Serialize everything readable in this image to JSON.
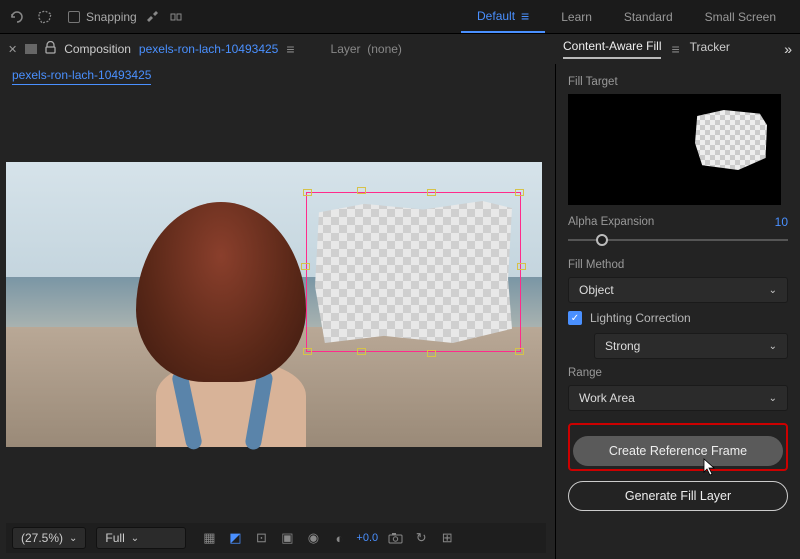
{
  "topbar": {
    "snapping_label": "Snapping"
  },
  "workspace": {
    "tabs": [
      "Default",
      "Learn",
      "Standard",
      "Small Screen"
    ],
    "active": "Default"
  },
  "comp_header": {
    "label": "Composition",
    "name": "pexels-ron-lach-10493425",
    "layer_label": "Layer",
    "layer_value": "(none)"
  },
  "breadcrumb": {
    "item": "pexels-ron-lach-10493425"
  },
  "right_tabs": {
    "tab1": "Content-Aware Fill",
    "tab2": "Tracker"
  },
  "caf": {
    "fill_target_label": "Fill Target",
    "alpha_label": "Alpha Expansion",
    "alpha_value": "10",
    "fill_method_label": "Fill Method",
    "fill_method_value": "Object",
    "lighting_label": "Lighting Correction",
    "lighting_value": "Strong",
    "range_label": "Range",
    "range_value": "Work Area",
    "ref_frame_btn": "Create Reference Frame",
    "gen_fill_btn": "Generate Fill Layer"
  },
  "bottombar": {
    "zoom": "(27.5%)",
    "res": "Full",
    "exposure": "+0.0"
  }
}
